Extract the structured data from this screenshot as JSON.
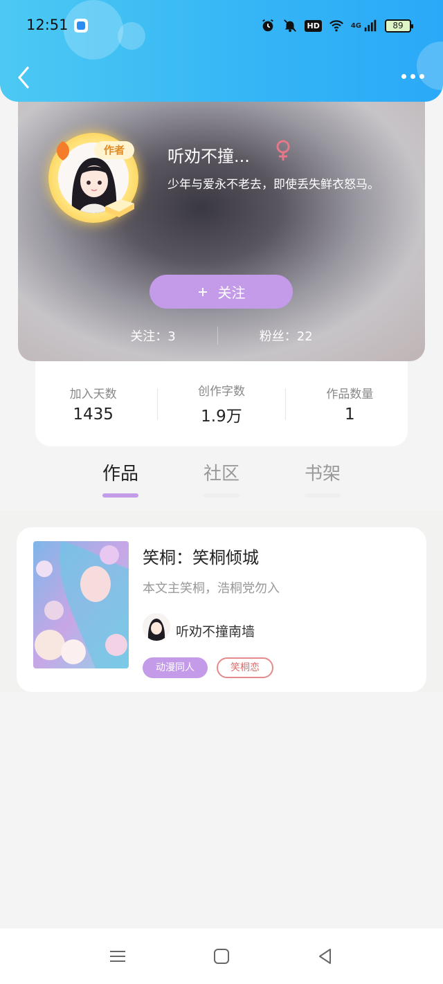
{
  "status_bar": {
    "time": "12:51",
    "battery": "89",
    "hd": "HD",
    "network": "4G"
  },
  "profile": {
    "badge": "作者",
    "name": "听劝不撞...",
    "signature": "少年与爱永不老去，即使丢失鲜衣怒马。",
    "follow_label": "关注",
    "follow_icon": "plus-icon",
    "following": "关注：3",
    "fans": "粉丝：22"
  },
  "numbers": [
    {
      "label": "加入天数",
      "value": "1435"
    },
    {
      "label": "创作字数",
      "value": "1.9万"
    },
    {
      "label": "作品数量",
      "value": "1"
    }
  ],
  "tabs": [
    {
      "label": "作品",
      "active": true
    },
    {
      "label": "社区",
      "active": false
    },
    {
      "label": "书架",
      "active": false
    }
  ],
  "book": {
    "title": "笑桐：笑桐倾城",
    "desc": "本文主笑桐，浩桐党勿入",
    "author": "听劝不撞南墙",
    "tags": [
      "动漫同人",
      "笑桐恋"
    ]
  },
  "colors": {
    "accent": "#c39be8",
    "header": "#36b6f5",
    "tag_outline": "#e48a8a"
  }
}
